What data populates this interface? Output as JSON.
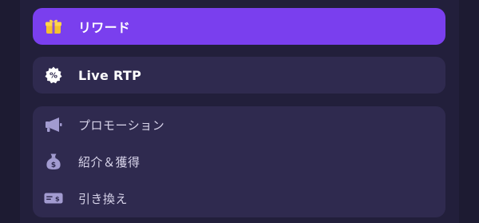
{
  "nav": {
    "reward": {
      "label": "リワード",
      "icon": "gift-icon"
    },
    "live_rtp": {
      "label": "Live RTP",
      "icon": "percent-badge-icon"
    },
    "menu": [
      {
        "label": "プロモーション",
        "icon": "megaphone-icon"
      },
      {
        "label": "紹介＆獲得",
        "icon": "money-bag-icon"
      },
      {
        "label": "引き換え",
        "icon": "ticket-icon"
      }
    ]
  },
  "colors": {
    "background": "#1d1b32",
    "active": "#7a3fee",
    "card": "#2f2a4f",
    "icon_muted": "#a29bd0"
  }
}
